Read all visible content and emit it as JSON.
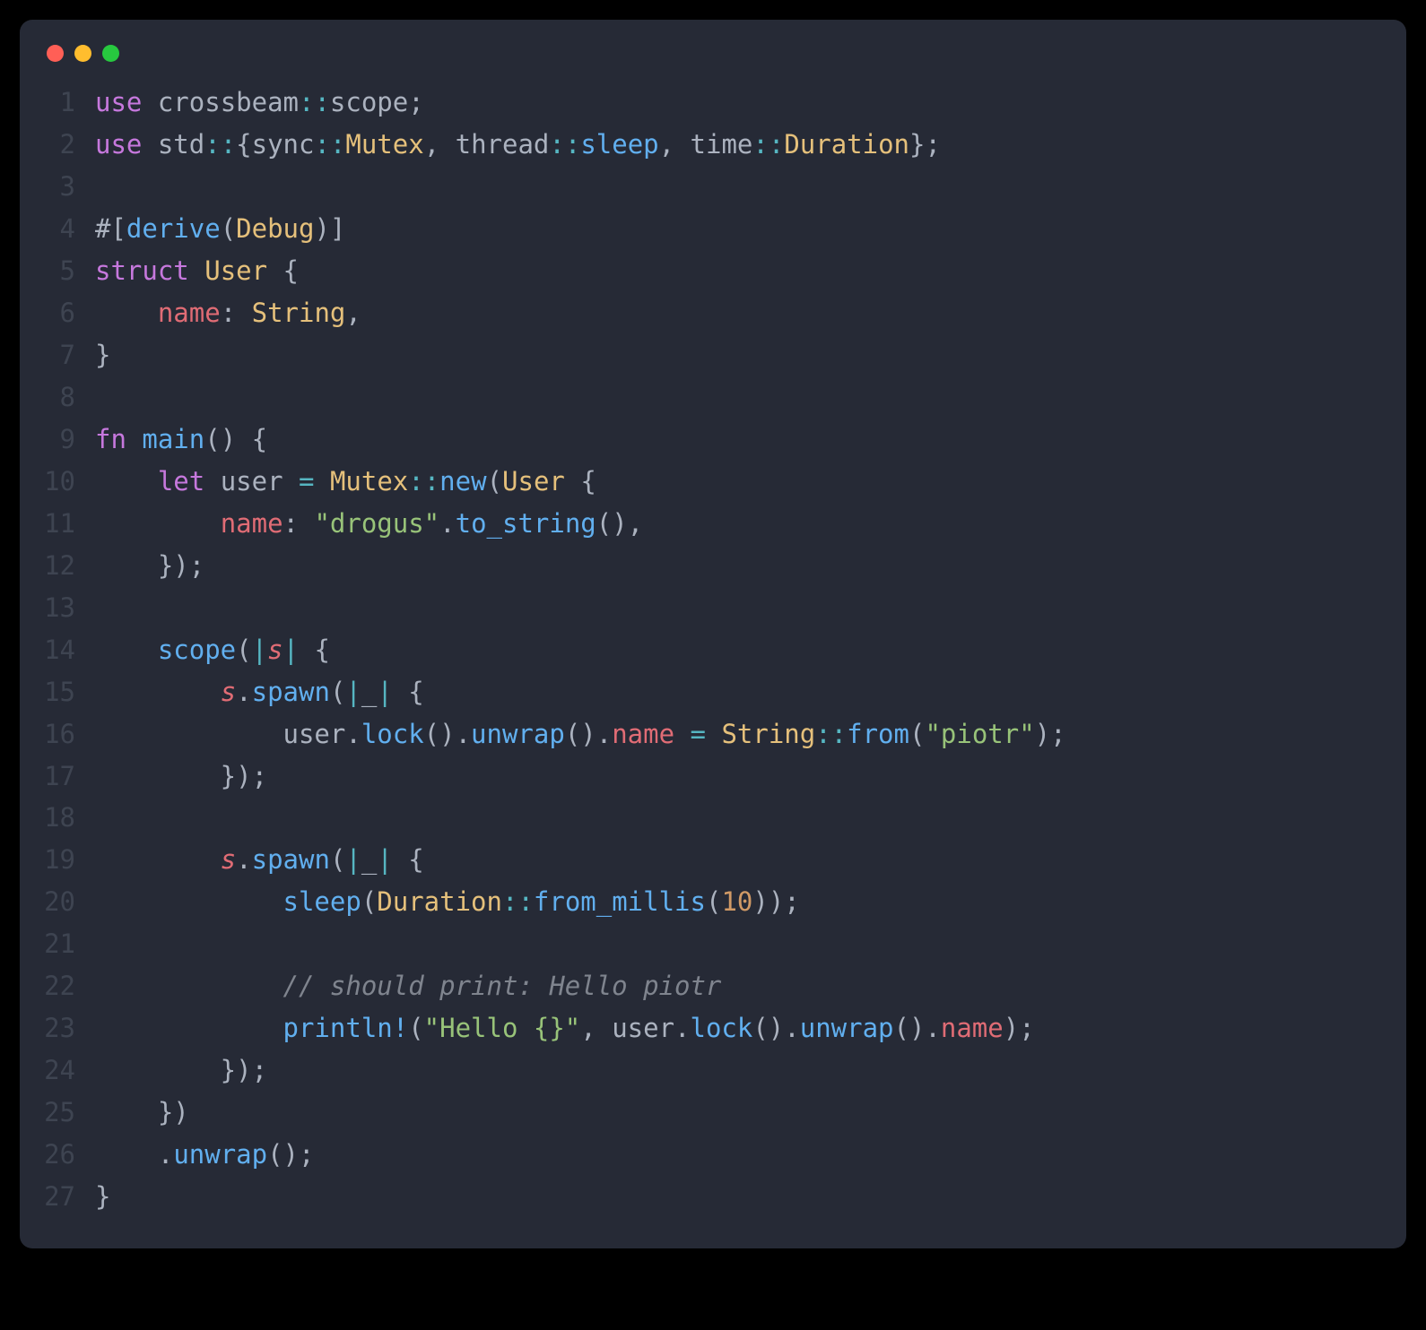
{
  "window_buttons": [
    "close",
    "minimize",
    "zoom"
  ],
  "language": "rust",
  "lines": [
    {
      "n": 1,
      "tokens": [
        [
          "kw",
          "use"
        ],
        [
          "pun",
          " crossbeam"
        ],
        [
          "op",
          "::"
        ],
        [
          "pun",
          "scope;"
        ]
      ]
    },
    {
      "n": 2,
      "tokens": [
        [
          "kw",
          "use"
        ],
        [
          "pun",
          " std"
        ],
        [
          "op",
          "::"
        ],
        [
          "pun",
          "{sync"
        ],
        [
          "op",
          "::"
        ],
        [
          "ty",
          "Mutex"
        ],
        [
          "pun",
          ", thread"
        ],
        [
          "op",
          "::"
        ],
        [
          "fn",
          "sleep"
        ],
        [
          "pun",
          ", time"
        ],
        [
          "op",
          "::"
        ],
        [
          "ty",
          "Duration"
        ],
        [
          "pun",
          "};"
        ]
      ]
    },
    {
      "n": 3,
      "tokens": []
    },
    {
      "n": 4,
      "tokens": [
        [
          "pun",
          "#["
        ],
        [
          "fn",
          "derive"
        ],
        [
          "pun",
          "("
        ],
        [
          "ty",
          "Debug"
        ],
        [
          "pun",
          ")]"
        ]
      ]
    },
    {
      "n": 5,
      "tokens": [
        [
          "kw",
          "struct"
        ],
        [
          "pun",
          " "
        ],
        [
          "ty",
          "User"
        ],
        [
          "pun",
          " {"
        ]
      ]
    },
    {
      "n": 6,
      "tokens": [
        [
          "pun",
          "    "
        ],
        [
          "id",
          "name"
        ],
        [
          "pun",
          ": "
        ],
        [
          "ty",
          "String"
        ],
        [
          "pun",
          ","
        ]
      ]
    },
    {
      "n": 7,
      "tokens": [
        [
          "pun",
          "}"
        ]
      ]
    },
    {
      "n": 8,
      "tokens": []
    },
    {
      "n": 9,
      "tokens": [
        [
          "kw",
          "fn"
        ],
        [
          "pun",
          " "
        ],
        [
          "fn",
          "main"
        ],
        [
          "pun",
          "() {"
        ]
      ]
    },
    {
      "n": 10,
      "tokens": [
        [
          "pun",
          "    "
        ],
        [
          "kw",
          "let"
        ],
        [
          "pun",
          " user "
        ],
        [
          "op",
          "="
        ],
        [
          "pun",
          " "
        ],
        [
          "ty",
          "Mutex"
        ],
        [
          "op",
          "::"
        ],
        [
          "fn",
          "new"
        ],
        [
          "pun",
          "("
        ],
        [
          "ty",
          "User"
        ],
        [
          "pun",
          " {"
        ]
      ]
    },
    {
      "n": 11,
      "tokens": [
        [
          "pun",
          "        "
        ],
        [
          "id",
          "name"
        ],
        [
          "pun",
          ": "
        ],
        [
          "str",
          "\"drogus\""
        ],
        [
          "pun",
          "."
        ],
        [
          "fn",
          "to_string"
        ],
        [
          "pun",
          "(),"
        ]
      ]
    },
    {
      "n": 12,
      "tokens": [
        [
          "pun",
          "    });"
        ]
      ]
    },
    {
      "n": 13,
      "tokens": []
    },
    {
      "n": 14,
      "tokens": [
        [
          "pun",
          "    "
        ],
        [
          "fn",
          "scope"
        ],
        [
          "pun",
          "("
        ],
        [
          "op",
          "|"
        ],
        [
          "id it",
          "s"
        ],
        [
          "op",
          "|"
        ],
        [
          "pun",
          " {"
        ]
      ]
    },
    {
      "n": 15,
      "tokens": [
        [
          "pun",
          "        "
        ],
        [
          "id it",
          "s"
        ],
        [
          "pun",
          "."
        ],
        [
          "fn",
          "spawn"
        ],
        [
          "pun",
          "("
        ],
        [
          "op",
          "|"
        ],
        [
          "pun",
          "_"
        ],
        [
          "op",
          "|"
        ],
        [
          "pun",
          " {"
        ]
      ]
    },
    {
      "n": 16,
      "tokens": [
        [
          "pun",
          "            user."
        ],
        [
          "fn",
          "lock"
        ],
        [
          "pun",
          "()."
        ],
        [
          "fn",
          "unwrap"
        ],
        [
          "pun",
          "()."
        ],
        [
          "id",
          "name"
        ],
        [
          "pun",
          " "
        ],
        [
          "op",
          "="
        ],
        [
          "pun",
          " "
        ],
        [
          "ty",
          "String"
        ],
        [
          "op",
          "::"
        ],
        [
          "fn",
          "from"
        ],
        [
          "pun",
          "("
        ],
        [
          "str",
          "\"piotr\""
        ],
        [
          "pun",
          ");"
        ]
      ]
    },
    {
      "n": 17,
      "tokens": [
        [
          "pun",
          "        });"
        ]
      ]
    },
    {
      "n": 18,
      "tokens": []
    },
    {
      "n": 19,
      "tokens": [
        [
          "pun",
          "        "
        ],
        [
          "id it",
          "s"
        ],
        [
          "pun",
          "."
        ],
        [
          "fn",
          "spawn"
        ],
        [
          "pun",
          "("
        ],
        [
          "op",
          "|"
        ],
        [
          "pun",
          "_"
        ],
        [
          "op",
          "|"
        ],
        [
          "pun",
          " {"
        ]
      ]
    },
    {
      "n": 20,
      "tokens": [
        [
          "pun",
          "            "
        ],
        [
          "fn",
          "sleep"
        ],
        [
          "pun",
          "("
        ],
        [
          "ty",
          "Duration"
        ],
        [
          "op",
          "::"
        ],
        [
          "fn",
          "from_millis"
        ],
        [
          "pun",
          "("
        ],
        [
          "num",
          "10"
        ],
        [
          "pun",
          "));"
        ]
      ]
    },
    {
      "n": 21,
      "tokens": []
    },
    {
      "n": 22,
      "tokens": [
        [
          "pun",
          "            "
        ],
        [
          "cm",
          "// should print: Hello piotr"
        ]
      ]
    },
    {
      "n": 23,
      "tokens": [
        [
          "pun",
          "            "
        ],
        [
          "fn",
          "println!"
        ],
        [
          "pun",
          "("
        ],
        [
          "str",
          "\"Hello {}\""
        ],
        [
          "pun",
          ", user."
        ],
        [
          "fn",
          "lock"
        ],
        [
          "pun",
          "()."
        ],
        [
          "fn",
          "unwrap"
        ],
        [
          "pun",
          "()."
        ],
        [
          "id",
          "name"
        ],
        [
          "pun",
          ");"
        ]
      ]
    },
    {
      "n": 24,
      "tokens": [
        [
          "pun",
          "        });"
        ]
      ]
    },
    {
      "n": 25,
      "tokens": [
        [
          "pun",
          "    })"
        ]
      ]
    },
    {
      "n": 26,
      "tokens": [
        [
          "pun",
          "    ."
        ],
        [
          "fn",
          "unwrap"
        ],
        [
          "pun",
          "();"
        ]
      ]
    },
    {
      "n": 27,
      "tokens": [
        [
          "pun",
          "}"
        ]
      ]
    }
  ]
}
